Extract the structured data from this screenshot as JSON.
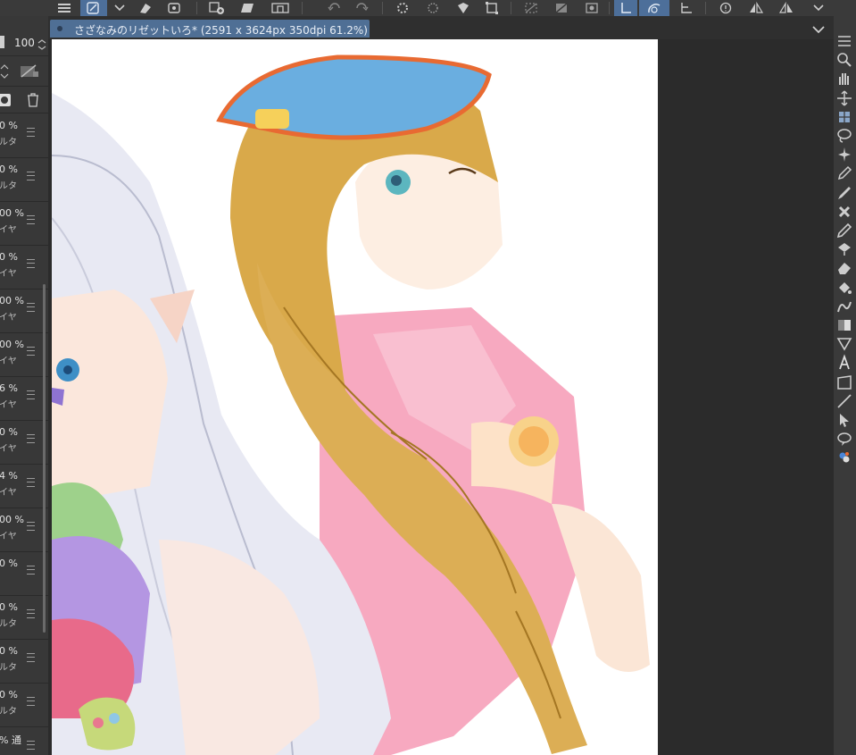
{
  "document": {
    "title": "さざなみのリゼットいろ* (2591 x 3624px 350dpi 61.2%)"
  },
  "layer_panel": {
    "opacity": "100",
    "layers": [
      {
        "pct": "0 %",
        "mode": "ルタ"
      },
      {
        "pct": "0 %",
        "mode": "ルタ"
      },
      {
        "pct": "00 %",
        "mode": "イヤ"
      },
      {
        "pct": "0 %",
        "mode": "イヤ"
      },
      {
        "pct": "00 %",
        "mode": "イヤ"
      },
      {
        "pct": "00 %",
        "mode": "イヤ"
      },
      {
        "pct": "6 %",
        "mode": "イヤ"
      },
      {
        "pct": "0 %",
        "mode": "イヤ"
      },
      {
        "pct": "4 %",
        "mode": "イヤ"
      },
      {
        "pct": "00 %",
        "mode": "イヤ"
      },
      {
        "pct": "0 %",
        "mode": ""
      },
      {
        "pct": "0 %",
        "mode": "ルタ"
      },
      {
        "pct": "0 %",
        "mode": "ルタ"
      },
      {
        "pct": "0 %",
        "mode": "ルタ"
      },
      {
        "pct": "% 通",
        "mode": ""
      }
    ]
  },
  "right_tools": {
    "icons": [
      "menu-icon",
      "zoom-icon",
      "hand-icon",
      "move-icon",
      "move-layer-icon",
      "lasso-icon",
      "magic-wand-icon",
      "eyedropper-icon",
      "pen-icon",
      "brush-icon",
      "pencil-icon",
      "airbrush-icon",
      "eraser-icon",
      "fill-icon",
      "blend-icon",
      "gradient-icon",
      "figure-icon",
      "text-icon",
      "frame-icon",
      "ruler-icon",
      "operation-icon",
      "balloon-icon",
      "color-icon"
    ]
  },
  "colors": {
    "toolbar": "#3a3a3a",
    "panel": "#383838",
    "canvas_bg": "#2b2b2b",
    "tab_active": "#4f6f95"
  }
}
